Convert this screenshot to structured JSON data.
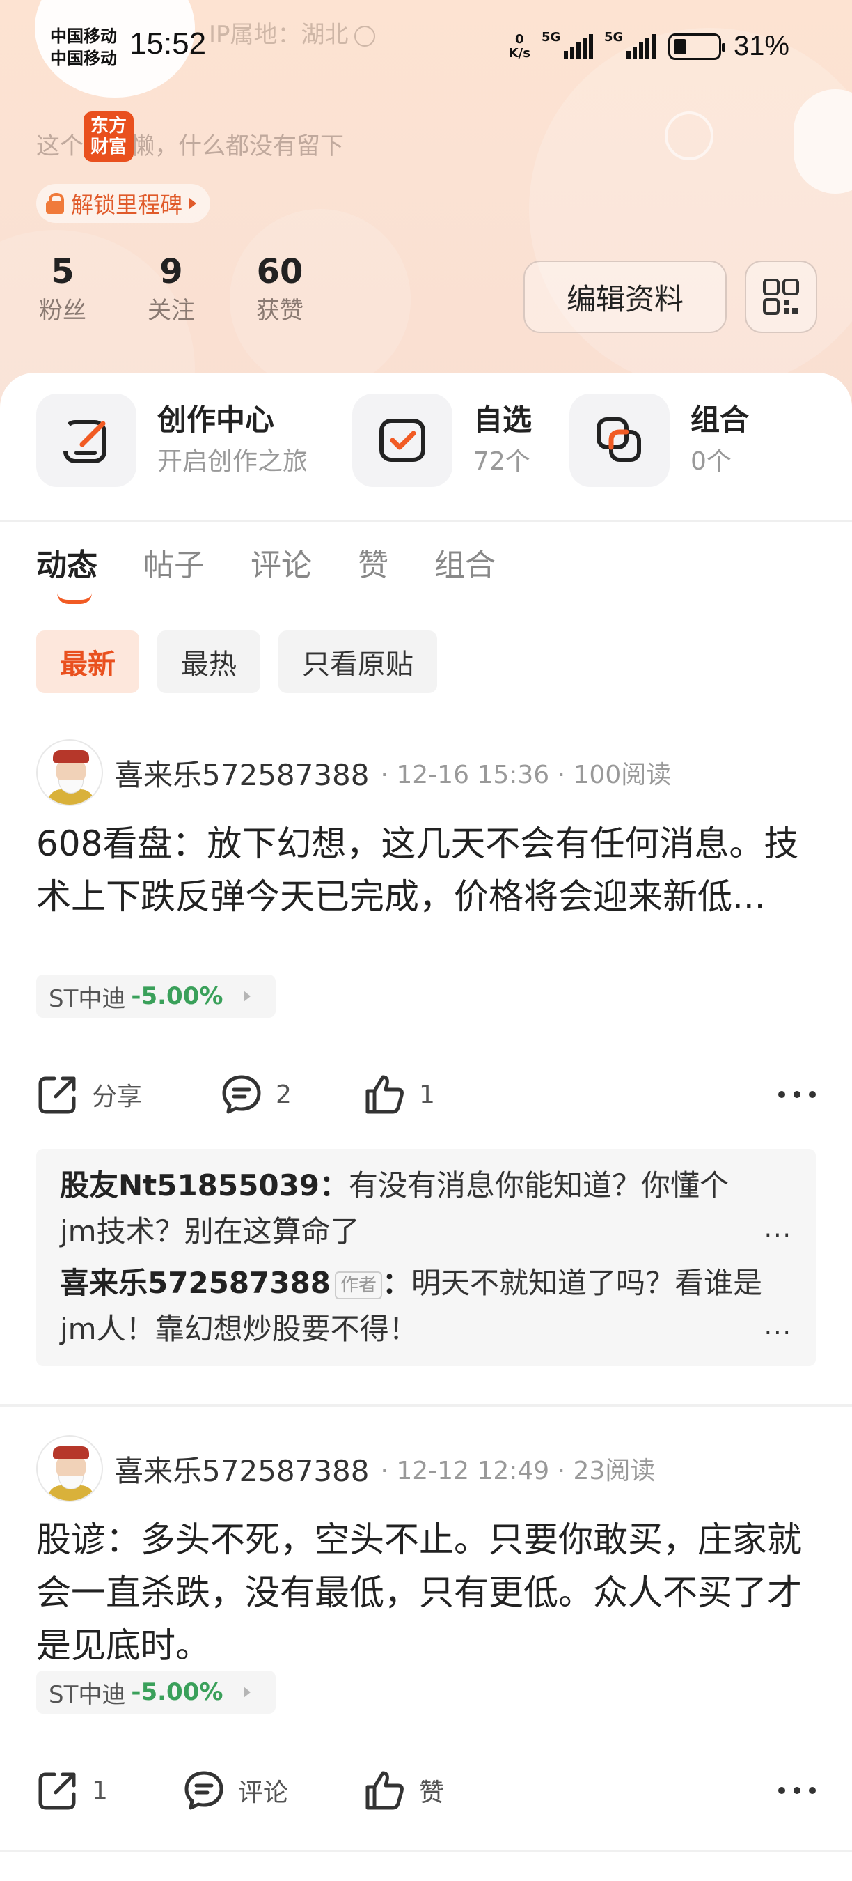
{
  "status_bar": {
    "carrier_1": "中国移动",
    "carrier_2": "中国移动",
    "time": "15:52",
    "net_speed_value": "0",
    "net_speed_unit": "K/s",
    "signal_1_label": "5G",
    "signal_2_label": "5G",
    "battery_percent": "31%",
    "battery_level": 0.31
  },
  "profile": {
    "ip_location": "IP属地：湖北",
    "bio": "这个人很懒，什么都没有留下",
    "logo_text_line1": "东方",
    "logo_text_line2": "财富",
    "milestone_label": "解锁里程碑",
    "stats": [
      {
        "value": "5",
        "label": "粉丝"
      },
      {
        "value": "9",
        "label": "关注"
      },
      {
        "value": "60",
        "label": "获赞"
      }
    ],
    "edit_button": "编辑资料"
  },
  "quick_links": [
    {
      "title": "创作中心",
      "subtitle": "开启创作之旅",
      "icon": "pen-edit-icon"
    },
    {
      "title": "自选",
      "subtitle": "72个",
      "icon": "checkbox-icon"
    },
    {
      "title": "组合",
      "subtitle": "0个",
      "icon": "overlap-squares-icon"
    }
  ],
  "tabs": [
    "动态",
    "帖子",
    "评论",
    "赞",
    "组合"
  ],
  "active_tab": "动态",
  "filters": [
    "最新",
    "最热",
    "只看原贴"
  ],
  "active_filter": "最新",
  "posts": [
    {
      "author": "喜来乐572587388",
      "meta": "· 12-16 15:36 · 100阅读",
      "text": "608看盘：放下幻想，这几天不会有任何消息。技术上下跌反弹今天已完成，价格将会迎来新低...",
      "stock_name": "ST中迪",
      "stock_change": "-5.00%",
      "share_label": "分享",
      "comment_label": "2",
      "like_label": "1",
      "comments": [
        {
          "user": "股友Nt51855039",
          "author_tag": "",
          "text": "有没有消息你能知道？你懂个jm技术？别在这算命了",
          "more": "..."
        },
        {
          "user": "喜来乐572587388",
          "author_tag": "作者",
          "text": "明天不就知道了吗？看谁是jm人！靠幻想炒股要不得！",
          "more": "..."
        }
      ]
    },
    {
      "author": "喜来乐572587388",
      "meta": "· 12-12 12:49 · 23阅读",
      "text": "股谚：多头不死，空头不止。只要你敢买，庄家就会一直杀跌，没有最低，只有更低。众人不买了才是见底时。",
      "stock_name": "ST中迪",
      "stock_change": "-5.00%",
      "share_label": "1",
      "comment_label": "评论",
      "like_label": "赞"
    }
  ],
  "colors": {
    "accent": "#f15b24",
    "down_green": "#3aa05a",
    "header_bg": "#fbe2d3"
  }
}
